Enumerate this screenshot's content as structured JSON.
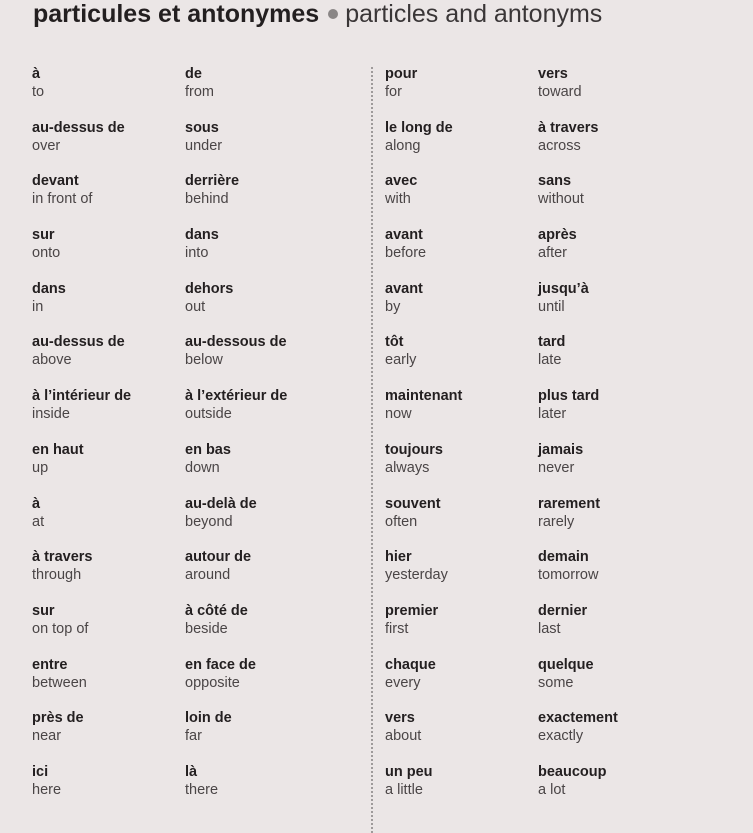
{
  "header": {
    "title_fr": "particules et antonymes",
    "title_en": "particles and antonyms"
  },
  "columns": [
    [
      {
        "fr": "à",
        "en": "to"
      },
      {
        "fr": "au-dessus de",
        "en": "over"
      },
      {
        "fr": "devant",
        "en": "in front of"
      },
      {
        "fr": "sur",
        "en": "onto"
      },
      {
        "fr": "dans",
        "en": "in"
      },
      {
        "fr": "au-dessus de",
        "en": "above"
      },
      {
        "fr": "à l’intérieur de",
        "en": "inside"
      },
      {
        "fr": "en haut",
        "en": "up"
      },
      {
        "fr": "à",
        "en": "at"
      },
      {
        "fr": "à travers",
        "en": "through"
      },
      {
        "fr": "sur",
        "en": "on top of"
      },
      {
        "fr": "entre",
        "en": "between"
      },
      {
        "fr": "près de",
        "en": "near"
      },
      {
        "fr": "ici",
        "en": "here"
      }
    ],
    [
      {
        "fr": "de",
        "en": "from"
      },
      {
        "fr": "sous",
        "en": "under"
      },
      {
        "fr": "derrière",
        "en": "behind"
      },
      {
        "fr": "dans",
        "en": "into"
      },
      {
        "fr": "dehors",
        "en": "out"
      },
      {
        "fr": "au-dessous de",
        "en": "below"
      },
      {
        "fr": "à l’extérieur de",
        "en": "outside"
      },
      {
        "fr": "en bas",
        "en": "down"
      },
      {
        "fr": "au-delà de",
        "en": "beyond"
      },
      {
        "fr": "autour de",
        "en": "around"
      },
      {
        "fr": "à côté de",
        "en": "beside"
      },
      {
        "fr": "en face de",
        "en": "opposite"
      },
      {
        "fr": "loin de",
        "en": "far"
      },
      {
        "fr": "là",
        "en": "there"
      }
    ],
    [
      {
        "fr": "pour",
        "en": "for"
      },
      {
        "fr": "le long de",
        "en": "along"
      },
      {
        "fr": "avec",
        "en": "with"
      },
      {
        "fr": "avant",
        "en": "before"
      },
      {
        "fr": "avant",
        "en": "by"
      },
      {
        "fr": "tôt",
        "en": "early"
      },
      {
        "fr": "maintenant",
        "en": "now"
      },
      {
        "fr": "toujours",
        "en": "always"
      },
      {
        "fr": "souvent",
        "en": "often"
      },
      {
        "fr": "hier",
        "en": "yesterday"
      },
      {
        "fr": "premier",
        "en": "first"
      },
      {
        "fr": "chaque",
        "en": "every"
      },
      {
        "fr": "vers",
        "en": "about"
      },
      {
        "fr": "un peu",
        "en": "a little"
      }
    ],
    [
      {
        "fr": "vers",
        "en": "toward"
      },
      {
        "fr": "à travers",
        "en": "across"
      },
      {
        "fr": "sans",
        "en": "without"
      },
      {
        "fr": "après",
        "en": "after"
      },
      {
        "fr": "jusqu’à",
        "en": "until"
      },
      {
        "fr": "tard",
        "en": "late"
      },
      {
        "fr": "plus tard",
        "en": "later"
      },
      {
        "fr": "jamais",
        "en": "never"
      },
      {
        "fr": "rarement",
        "en": "rarely"
      },
      {
        "fr": "demain",
        "en": "tomorrow"
      },
      {
        "fr": "dernier",
        "en": "last"
      },
      {
        "fr": "quelque",
        "en": "some"
      },
      {
        "fr": "exactement",
        "en": "exactly"
      },
      {
        "fr": "beaucoup",
        "en": "a lot"
      }
    ]
  ]
}
